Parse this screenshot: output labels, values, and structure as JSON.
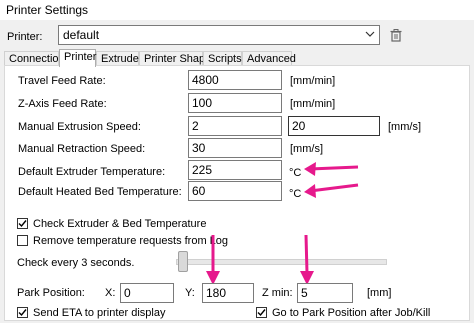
{
  "window": {
    "title": "Printer Settings"
  },
  "printer": {
    "label": "Printer:",
    "value": "default"
  },
  "tabs": [
    "Connection",
    "Printer",
    "Extruder",
    "Printer Shape",
    "Scripts",
    "Advanced"
  ],
  "fields": {
    "travel_feed_rate": {
      "label": "Travel Feed Rate:",
      "value": "4800",
      "unit": "[mm/min]"
    },
    "z_axis_feed_rate": {
      "label": "Z-Axis Feed Rate:",
      "value": "100",
      "unit": "[mm/min]"
    },
    "manual_extrusion_speed": {
      "label": "Manual Extrusion Speed:",
      "value": "2",
      "value2": "20",
      "unit": "[mm/s]"
    },
    "manual_retraction_speed": {
      "label": "Manual Retraction Speed:",
      "value": "30",
      "unit": "[mm/s]"
    },
    "default_extruder_temp": {
      "label": "Default Extruder Temperature:",
      "value": "225",
      "unit": "°C"
    },
    "default_bed_temp": {
      "label": "Default Heated Bed Temperature:",
      "value": "60",
      "unit": "°C"
    }
  },
  "checks": {
    "check_temp": {
      "label": "Check Extruder & Bed Temperature",
      "checked": true
    },
    "remove_temp_requests": {
      "label": "Remove temperature requests from Log",
      "checked": false
    },
    "send_eta": {
      "label": "Send ETA to printer display",
      "checked": true
    },
    "go_to_park": {
      "label": "Go to Park Position after Job/Kill",
      "checked": true
    }
  },
  "check_every": {
    "label": "Check every 3 seconds.",
    "level": 0.03
  },
  "park": {
    "label": "Park Position:",
    "x_label": "X:",
    "x_value": "0",
    "y_label": "Y:",
    "y_value": "180",
    "zmin_label": "Z min:",
    "zmin_value": "5",
    "unit": "[mm]"
  },
  "colors": {
    "annotation": "#e6198c"
  }
}
